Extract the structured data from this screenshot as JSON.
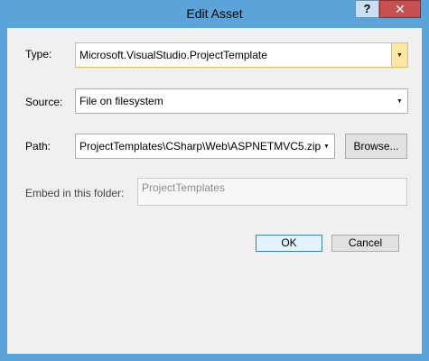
{
  "window": {
    "title": "Edit Asset",
    "help_glyph": "?",
    "close_glyph": "✕"
  },
  "form": {
    "type_label": "Type:",
    "type_value": "Microsoft.VisualStudio.ProjectTemplate",
    "source_label": "Source:",
    "source_value": "File on filesystem",
    "path_label": "Path:",
    "path_value": "ProjectTemplates\\CSharp\\Web\\ASPNETMVC5.zip",
    "browse_label": "Browse...",
    "embed_label": "Embed in this folder:",
    "embed_value": "ProjectTemplates",
    "ok_label": "OK",
    "cancel_label": "Cancel"
  },
  "icons": {
    "dropdown": "▼"
  },
  "colors": {
    "frame": "#5aa4da",
    "close_button": "#c75050",
    "type_highlight": "#e3c15a"
  }
}
